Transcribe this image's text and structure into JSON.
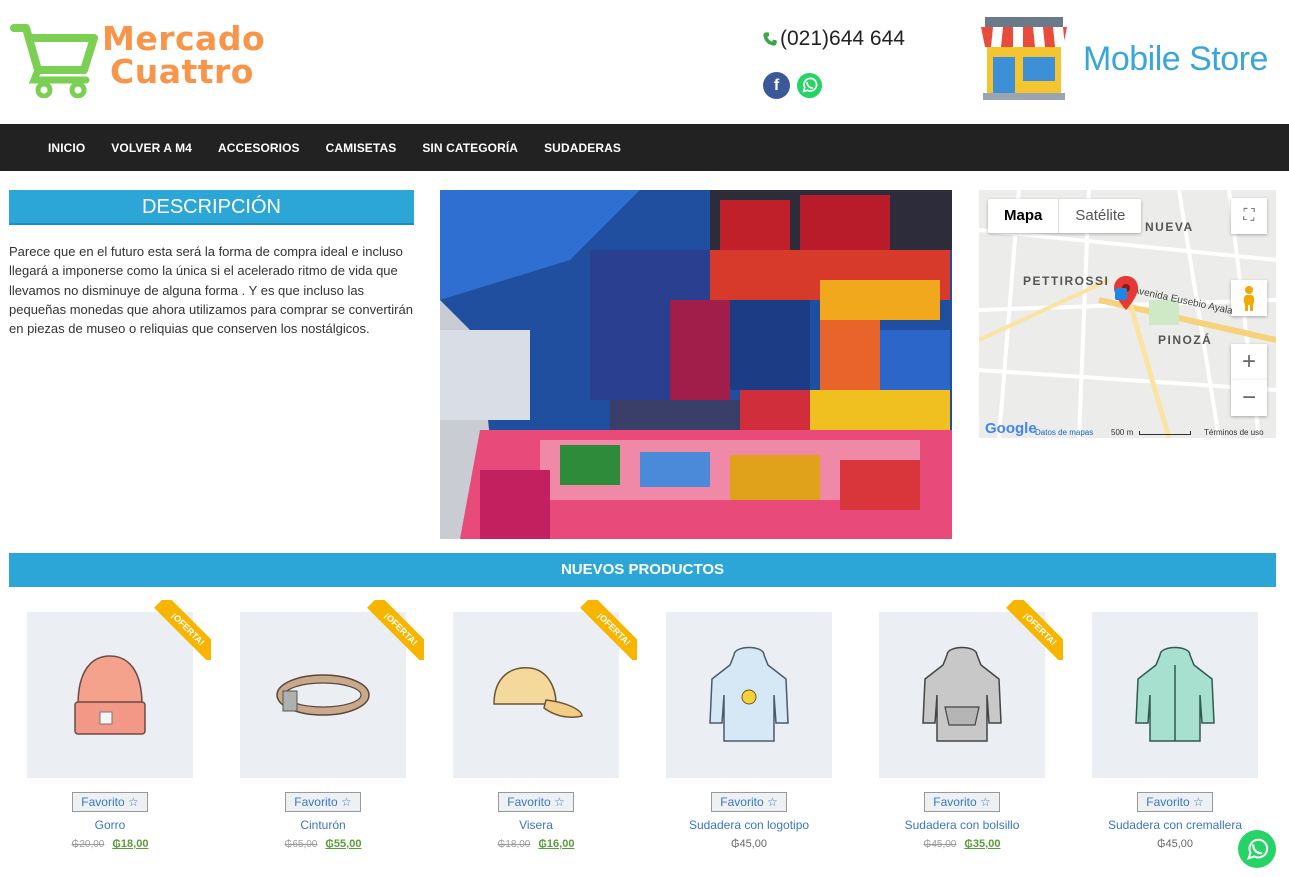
{
  "header": {
    "brand_line1": "Mercado",
    "brand_line2": "Cuattro",
    "phone": "(021)644 644",
    "store_name": "Mobile Store"
  },
  "nav": {
    "items": [
      "INICIO",
      "VOLVER A M4",
      "ACCESORIOS",
      "CAMISETAS",
      "SIN CATEGORÍA",
      "SUDADERAS"
    ]
  },
  "description": {
    "title": "DESCRIPCIÓN",
    "body": "Parece que en el futuro esta será la forma de compra ideal e incluso llegará a imponerse como la única si el acelerado ritmo de vida que llevamos no disminuye de alguna forma . Y es que incluso las pequeñas monedas que ahora utilizamos para comprar se convertirán en piezas de museo o reliquias que conserven los nostálgicos."
  },
  "map": {
    "tab_map": "Mapa",
    "tab_satellite": "Satélite",
    "labels": [
      "NUEVA",
      "PETTIROSSI",
      "PINOZÁ"
    ],
    "street": "Avenida Eusebio Ayala",
    "footer_data": "Datos de mapas",
    "footer_scale": "500 m",
    "footer_terms": "Términos de uso",
    "google": "Google"
  },
  "new_products": {
    "title": "NUEVOS PRODUCTOS",
    "fav_label": "Favorito ☆",
    "ribbon_label": "¡OFERTA!",
    "items": [
      {
        "name": "Gorro",
        "old_price": "₲20,00",
        "price": "₲18,00",
        "sale": true
      },
      {
        "name": "Cinturón",
        "old_price": "₲65,00",
        "price": "₲55,00",
        "sale": true
      },
      {
        "name": "Visera",
        "old_price": "₲18,00",
        "price": "₲16,00",
        "sale": true
      },
      {
        "name": "Sudadera con logotipo",
        "old_price": "",
        "price": "₲45,00",
        "sale": false
      },
      {
        "name": "Sudadera con bolsillo",
        "old_price": "₲45,00",
        "price": "₲35,00",
        "sale": true
      },
      {
        "name": "Sudadera con cremallera",
        "old_price": "",
        "price": "₲45,00",
        "sale": false
      }
    ]
  },
  "colors": {
    "accent_blue": "#2ba6d6",
    "brand_orange": "#f7964a",
    "brand_green": "#7bcf53",
    "nav_bg": "#222222",
    "ribbon": "#f7b500"
  }
}
